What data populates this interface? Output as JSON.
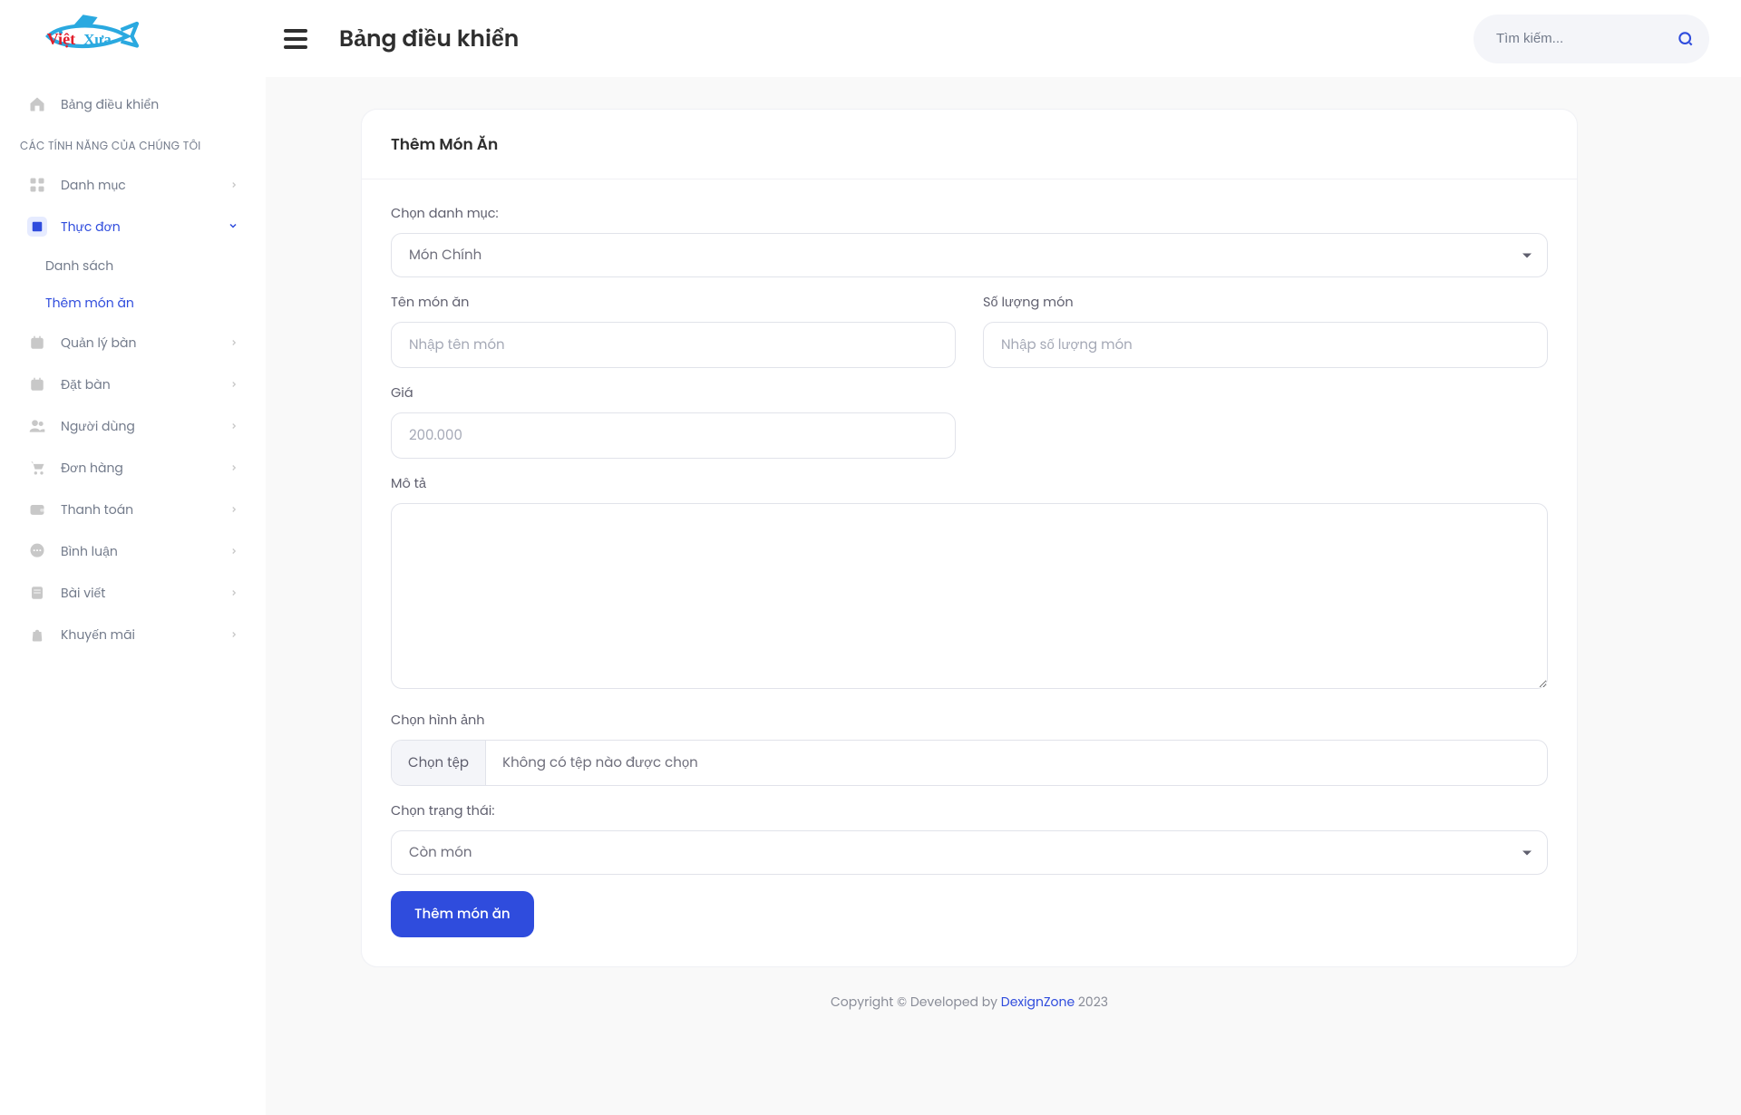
{
  "header": {
    "title": "Bảng điều khiển",
    "search_placeholder": "Tìm kiếm..."
  },
  "sidebar": {
    "dashboard_label": "Bảng điều khiển",
    "section_title": "CÁC TÍNH NĂNG CỦA CHÚNG TÔI",
    "items": {
      "category": "Danh mục",
      "menu": "Thực đơn",
      "menu_sub_list": "Danh sách",
      "menu_sub_add": "Thêm món ăn",
      "tables": "Quản lý bàn",
      "booking": "Đặt bàn",
      "users": "Người dùng",
      "orders": "Đơn hàng",
      "payments": "Thanh toán",
      "comments": "Bình luận",
      "posts": "Bài viết",
      "promotions": "Khuyến mãi"
    }
  },
  "form": {
    "card_title": "Thêm Món Ăn",
    "category_label": "Chọn danh mục:",
    "category_selected": "Món Chính",
    "name_label": "Tên món ăn",
    "name_placeholder": "Nhập tên món",
    "qty_label": "Số lượng món",
    "qty_placeholder": "Nhập số lượng món",
    "price_label": "Giá",
    "price_placeholder": "200.000",
    "desc_label": "Mô tả",
    "image_label": "Chọn hình ảnh",
    "file_button": "Chọn tệp",
    "file_placeholder": "Không có tệp nào được chọn",
    "status_label": "Chọn trạng thái:",
    "status_selected": "Còn món",
    "submit_label": "Thêm món ăn"
  },
  "footer": {
    "before": "Copyright © Developed by ",
    "link": "DexignZone",
    "after": " 2023"
  }
}
